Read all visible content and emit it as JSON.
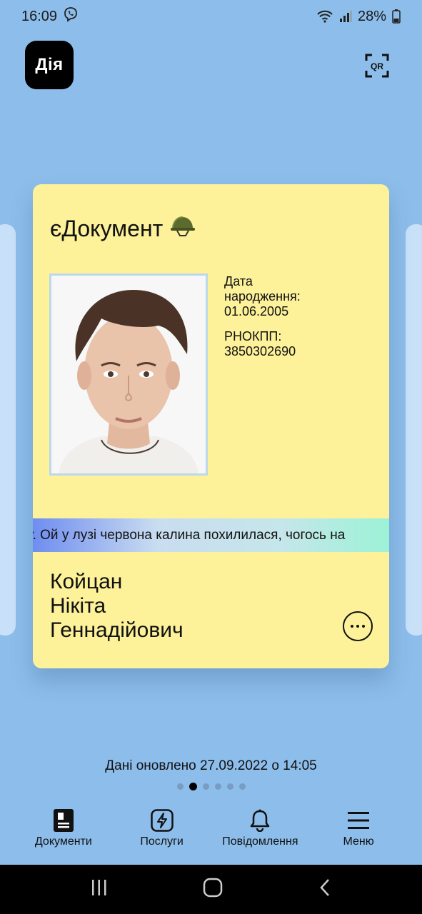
{
  "status_bar": {
    "time": "16:09",
    "battery": "28%",
    "icons": [
      "viber-icon",
      "wifi-icon",
      "signal-icon",
      "battery-icon"
    ]
  },
  "header": {
    "logo_text": "Дія",
    "qr_label": "QR"
  },
  "card": {
    "title": "єДокумент",
    "title_emoji": "🪖",
    "birth_label_1": "Дата",
    "birth_label_2": "народження:",
    "birth_date": "01.06.2005",
    "tax_label": "РНОКПП:",
    "tax_number": "3850302690",
    "ticker_text": "у. Ой у лузі червона калина похилилася, чогось на",
    "name_last": "Койцан",
    "name_first": "Нікіта",
    "name_middle": "Геннадійович",
    "background": "#fdf29a"
  },
  "updated_text": "Дані оновлено 27.09.2022 о 14:05",
  "pagination": {
    "count": 6,
    "active_index": 1
  },
  "bottom_nav": {
    "documents": "Документи",
    "services": "Послуги",
    "notifications": "Повідомлення",
    "menu": "Меню"
  },
  "colors": {
    "background": "#8dbdea",
    "card": "#fdf29a",
    "side_card": "#c8e0f8"
  }
}
